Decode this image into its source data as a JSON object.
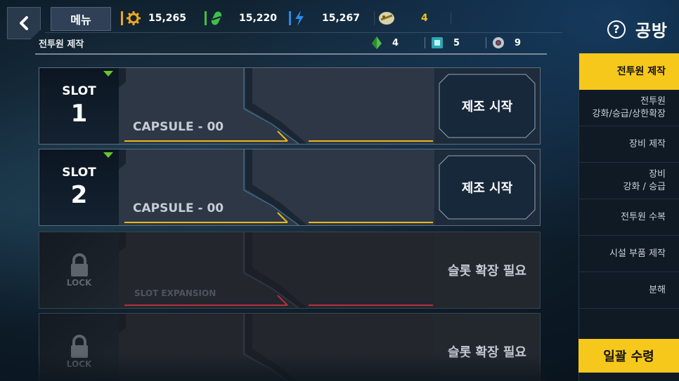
{
  "header": {
    "menu_label": "메뉴",
    "back_icon": "chevron-left-icon",
    "section_title": "전투원 제작",
    "help_label": "공방",
    "help_icon_glyph": "?"
  },
  "resources": [
    {
      "icon": "gear-icon",
      "color": "#f2a81b",
      "value": "15,265"
    },
    {
      "icon": "capsule-icon",
      "color": "#3fbf4a",
      "value": "15,220"
    },
    {
      "icon": "lightning-icon",
      "color": "#2b8be8",
      "value": "15,267"
    },
    {
      "icon": "ticket-icon",
      "color": "#f2c21b",
      "value": "4"
    }
  ],
  "mini_resources": [
    {
      "icon": "green-crystal-icon",
      "value": "4"
    },
    {
      "icon": "cyan-chip-icon",
      "value": "5"
    },
    {
      "icon": "gear-part-icon",
      "value": "9"
    }
  ],
  "slots": [
    {
      "label": "SLOT",
      "number": "1",
      "capsule": "CAPSULE - 00",
      "action": "제조 시작",
      "locked": false
    },
    {
      "label": "SLOT",
      "number": "2",
      "capsule": "CAPSULE - 00",
      "action": "제조 시작",
      "locked": false
    },
    {
      "lock_text": "LOCK",
      "capsule": "SLOT EXPANSION",
      "action": "슬롯 확장 필요",
      "locked": true
    },
    {
      "lock_text": "LOCK",
      "capsule": "",
      "action": "슬롯 확장 필요",
      "locked": true
    }
  ],
  "sidebar": {
    "items": [
      {
        "line1": "전투원 제작",
        "line2": "",
        "active": true
      },
      {
        "line1": "전투원",
        "line2": "강화/승급/상한확장",
        "active": false
      },
      {
        "line1": "장비 제작",
        "line2": "",
        "active": false
      },
      {
        "line1": "장비",
        "line2": "강화 / 승급",
        "active": false
      },
      {
        "line1": "전투원 수복",
        "line2": "",
        "active": false
      },
      {
        "line1": "시설 부품 제작",
        "line2": "",
        "active": false
      },
      {
        "line1": "분해",
        "line2": "",
        "active": false
      }
    ],
    "collect_all_label": "일괄 수령"
  },
  "colors": {
    "accent_yellow": "#f6c81b",
    "slot_indicator_green": "#67c52e",
    "active_line_yellow": "#e8b91a",
    "locked_line_red": "#b3313d"
  }
}
